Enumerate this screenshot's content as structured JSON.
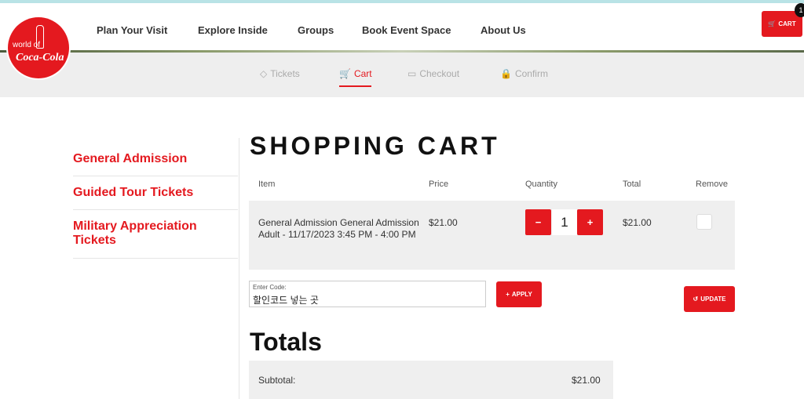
{
  "header": {
    "logo_line1": "world of",
    "logo_line2": "Coca-Cola",
    "nav": [
      "Plan Your Visit",
      "Explore Inside",
      "Groups",
      "Book Event Space",
      "About Us"
    ],
    "cart_label": "CART",
    "cart_badge": "1"
  },
  "steps": [
    "Tickets",
    "Cart",
    "Checkout",
    "Confirm"
  ],
  "active_step": "Cart",
  "sidebar": {
    "items": [
      "General Admission",
      "Guided Tour Tickets",
      "Military Appreciation Tickets"
    ]
  },
  "cart": {
    "title": "SHOPPING CART",
    "columns": [
      "Item",
      "Price",
      "Quantity",
      "Total",
      "Remove"
    ],
    "rows": [
      {
        "item": "General Admission General Admission Adult   - 11/17/2023 3:45 PM - 4:00 PM",
        "price": "$21.00",
        "quantity": "1",
        "total": "$21.00",
        "remove_checked": false
      }
    ],
    "minus": "−",
    "plus": "+"
  },
  "promo": {
    "label": "Enter Code:",
    "value": "할인코드 넣는 곳",
    "apply_label": "APPLY",
    "update_label": "UPDATE"
  },
  "totals": {
    "title": "Totals",
    "subtotal_label": "Subtotal:",
    "subtotal_value": "$21.00"
  },
  "colors": {
    "accent": "#e4191f",
    "panel": "#efefef",
    "steps_bg": "#eeeeee"
  }
}
